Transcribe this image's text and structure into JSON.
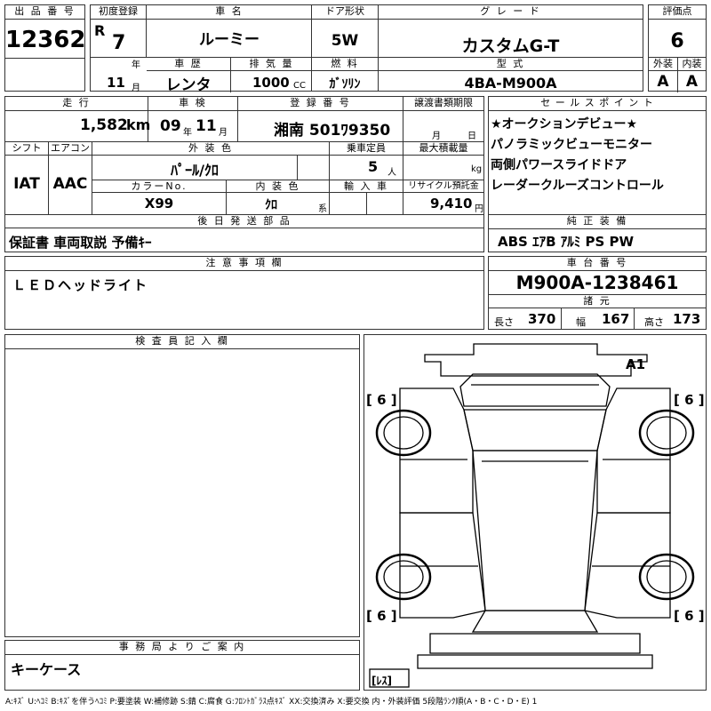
{
  "top": {
    "lot_no_label": "出 品 番 号",
    "lot_no": "12362",
    "first_reg_label": "初度登録",
    "era_prefix": "R",
    "reg_year": "7",
    "year_unit": "年",
    "reg_month": "11",
    "month_unit": "月",
    "car_name_label": "車 名",
    "car_name": "ルーミー",
    "history_label": "車 歴",
    "history": "レンタ",
    "displacement_label": "排 気 量",
    "displacement": "1000",
    "cc_unit": "CC",
    "door_label": "ドア形状",
    "door": "5W",
    "fuel_label": "燃 料",
    "fuel": "ｶﾞｿﾘﾝ",
    "grade_label": "グ レ ー ド",
    "grade": "カスタムG-T",
    "model_label": "型 式",
    "model": "4BA-M900A",
    "score_label": "評価点",
    "score": "6",
    "exterior_label": "外装",
    "exterior": "A",
    "interior_label": "内装",
    "interior": "A"
  },
  "mid": {
    "mileage_label": "走 行",
    "mileage": "1,582",
    "km_unit": "km",
    "inspection_label": "車 検",
    "insp_year": "09",
    "insp_year_unit": "年",
    "insp_month": "11",
    "insp_month_unit": "月",
    "plate_label": "登 録 番 号",
    "plate": "湘南 501ﾜ9350",
    "transfer_label": "譲渡書類期限",
    "transfer_month_unit": "月",
    "transfer_day_unit": "日",
    "shift_label": "シフト",
    "shift": "IAT",
    "ac_label": "エアコン",
    "ac": "AAC",
    "color_label": "外 装 色",
    "color": "ﾊﾟｰﾙ/ｸﾛ",
    "capacity_label": "乗車定員",
    "capacity": "5",
    "capacity_unit": "人",
    "max_load_label": "最大積載量",
    "max_load_unit": "kg",
    "color_no_label": "カラーNo.",
    "color_no": "X99",
    "int_color_label": "内 装 色",
    "int_color": "ｸﾛ",
    "int_color_unit": "系",
    "import_label": "輸 入 車",
    "recycle_label": "リサイクル預託金",
    "recycle": "9,410",
    "recycle_unit": "円",
    "later_label": "後 日 発 送 部 品",
    "later": "保証書 車両取説 予備ｷｰ"
  },
  "sales": {
    "label": "セ ー ル ス ポ イ ン ト",
    "lines": [
      "★オークションデビュー★",
      "パノラミックビューモニター",
      "両側パワースライドドア",
      "レーダークルーズコントロール"
    ]
  },
  "equipment": {
    "label": "純 正 装 備",
    "value": "ABS ｴｱB ｱﾙﾐ PS PW"
  },
  "caution": {
    "label": "注 意 事 項 欄",
    "value": "ＬＥＤヘッドライト"
  },
  "chassis": {
    "label": "車 台 番 号",
    "value": "M900A-1238461",
    "spec_label": "諸 元",
    "length_label": "長さ",
    "length": "370",
    "width_label": "幅",
    "width": "167",
    "height_label": "高さ",
    "height": "173"
  },
  "inspector": {
    "label": "検 査 員 記 入 欄"
  },
  "office": {
    "label": "事 務 局 よ り ご 案 内",
    "value": "キーケース"
  },
  "diagram": {
    "mark_a1": "A1",
    "tire_fl": "[ 6 ]",
    "tire_fr": "[ 6 ]",
    "tire_rl": "[ 6 ]",
    "tire_rr": "[ 6 ]",
    "spare": "[ﾚｽ]"
  },
  "legend": "A:ｷｽﾞ U:ﾍｺﾐ B:ｷｽﾞを伴うﾍｺﾐ P:要塗装 W:補修跡 S:錆 C:腐食 G:ﾌﾛﾝﾄｶﾞﾗｽ点ｷｽﾞ XX:交換済み X:要交換 内・外装評価 5段階ﾗﾝｸ順(A・B・C・D・E) 1"
}
